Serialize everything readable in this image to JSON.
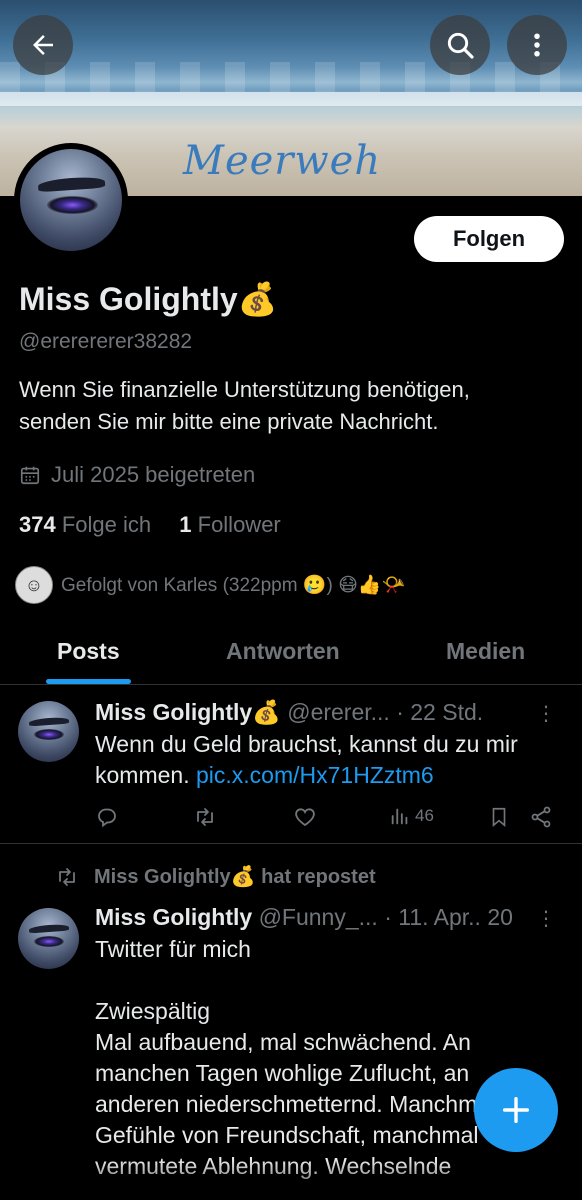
{
  "header": {
    "banner_text": "Meerweh",
    "back_icon": "arrow-left-icon",
    "search_icon": "search-icon",
    "more_icon": "more-vertical-icon"
  },
  "profile": {
    "follow_label": "Folgen",
    "name": "Miss Golightly",
    "name_emoji": "💰",
    "handle": "@ererererer38282",
    "bio_line1": "Wenn Sie finanzielle Unterstützung benötigen,",
    "bio_line2": "senden Sie mir bitte eine private Nachricht.",
    "joined": "Juli 2025 beigetreten",
    "following_count": "374",
    "following_label": "Folge ich",
    "followers_count": "1",
    "followers_label": "Follower",
    "followed_by": "Gefolgt von Karles (322ppm 🥲) 😷👍📯"
  },
  "tabs": [
    {
      "label": "Posts",
      "active": true
    },
    {
      "label": "Antworten",
      "active": false
    },
    {
      "label": "Medien",
      "active": false
    }
  ],
  "posts": [
    {
      "name": "Miss Golightly",
      "name_emoji": "💰",
      "handle": "@ererer...",
      "time": "· 22 Std.",
      "text_line1": "Wenn du Geld brauchst, kannst du zu mir",
      "text_line2_prefix": "kommen. ",
      "link": "pic.x.com/Hx71HZztm6",
      "views": "46"
    },
    {
      "repost_label": "Miss Golightly💰 hat repostet",
      "name": "Miss Golightly",
      "handle": "@Funny_...",
      "time": "· 11. Apr.. 20",
      "line1": "Twitter für mich",
      "line2": "Zwiespältig",
      "line3": "Mal aufbauend, mal schwächend. An",
      "line4": "manchen Tagen wohlige Zuflucht, an",
      "line5": "anderen niederschmetternd. Manchmal",
      "line6": "Gefühle von Freundschaft, manchmal",
      "line7": "vermutete Ablehnung. Wechselnde"
    }
  ]
}
